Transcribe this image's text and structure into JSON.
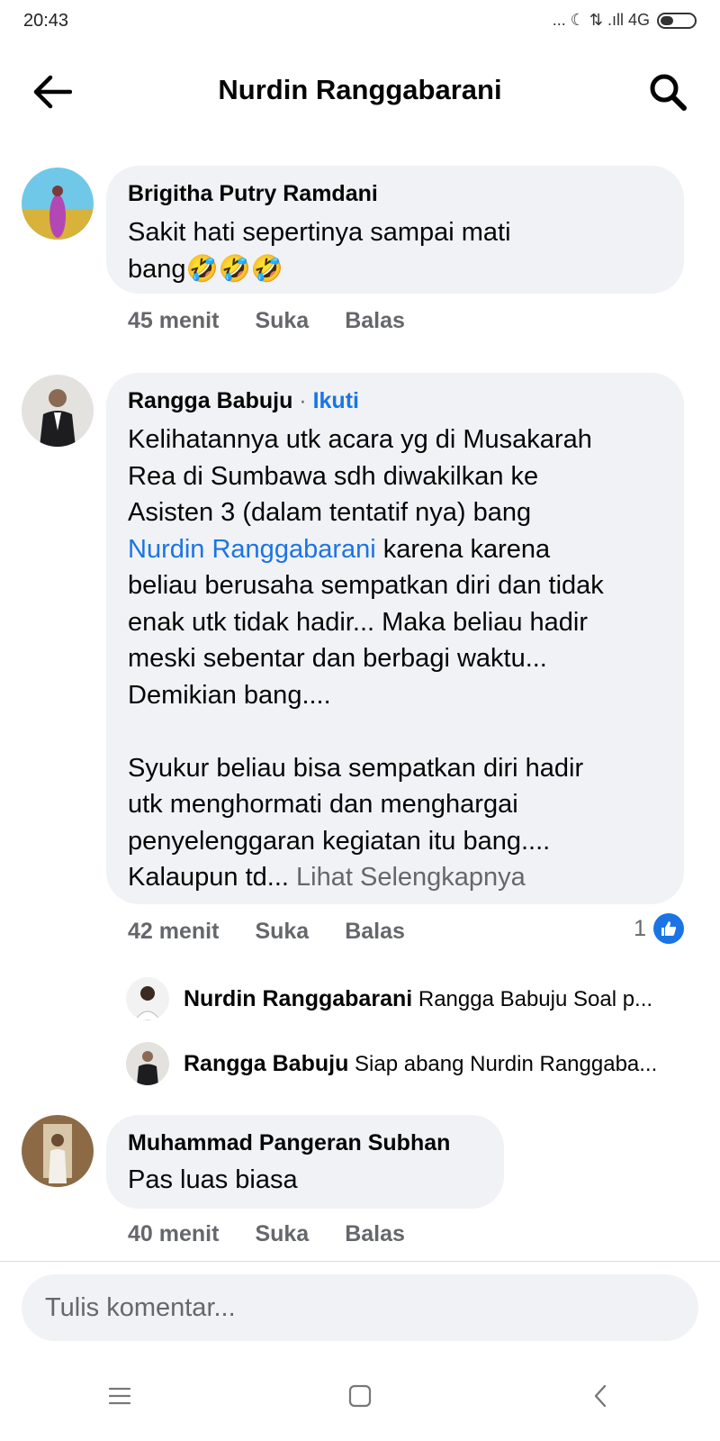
{
  "status": {
    "time": "20:43",
    "indicators": "... ☾ ⇅ .ıll 4G"
  },
  "header": {
    "title": "Nurdin Ranggabarani",
    "back_icon": "back-arrow-icon",
    "search_icon": "search-icon"
  },
  "comments": [
    {
      "author": "Brigitha Putry Ramdani",
      "text": "Sakit hati sepertinya sampai mati\nbang🤣🤣🤣",
      "time": "45 menit",
      "like_label": "Suka",
      "reply_label": "Balas"
    },
    {
      "author": "Rangga Babuju",
      "separator": "·",
      "follow_label": "Ikuti",
      "text_part1": "Kelihatannya utk acara yg di Musakarah\nRea di Sumbawa sdh diwakilkan ke\nAsisten 3 (dalam tentatif nya) bang\n",
      "mention": "Nurdin Ranggabarani",
      "text_part2": " karena karena\nbeliau berusaha sempatkan diri dan tidak\nenak utk tidak hadir... Maka beliau hadir\nmeski sebentar dan berbagi waktu...\nDemikian bang....\n\nSyukur beliau bisa sempatkan diri hadir\nutk menghormati dan menghargai\npenyelenggaran kegiatan itu bang....\nKalaupun td... ",
      "see_more": "Lihat Selengkapnya",
      "time": "42 menit",
      "like_label": "Suka",
      "reply_label": "Balas",
      "reaction_count": "1"
    },
    {
      "author": "Muhammad Pangeran Subhan",
      "text": "Pas luas biasa",
      "time": "40 menit",
      "like_label": "Suka",
      "reply_label": "Balas"
    }
  ],
  "replies": [
    {
      "author": "Nurdin Ranggabarani",
      "text": "Rangga Babuju Soal p..."
    },
    {
      "author": "Rangga Babuju",
      "text": "Siap abang Nurdin Ranggaba..."
    }
  ],
  "composer": {
    "placeholder": "Tulis komentar..."
  },
  "navbar": {
    "items": [
      "menu-icon",
      "home-square-icon",
      "back-chevron-icon"
    ]
  },
  "colors": {
    "accent": "#1b74e4",
    "bubble": "#f0f2f5",
    "secondary_text": "#65676b"
  }
}
